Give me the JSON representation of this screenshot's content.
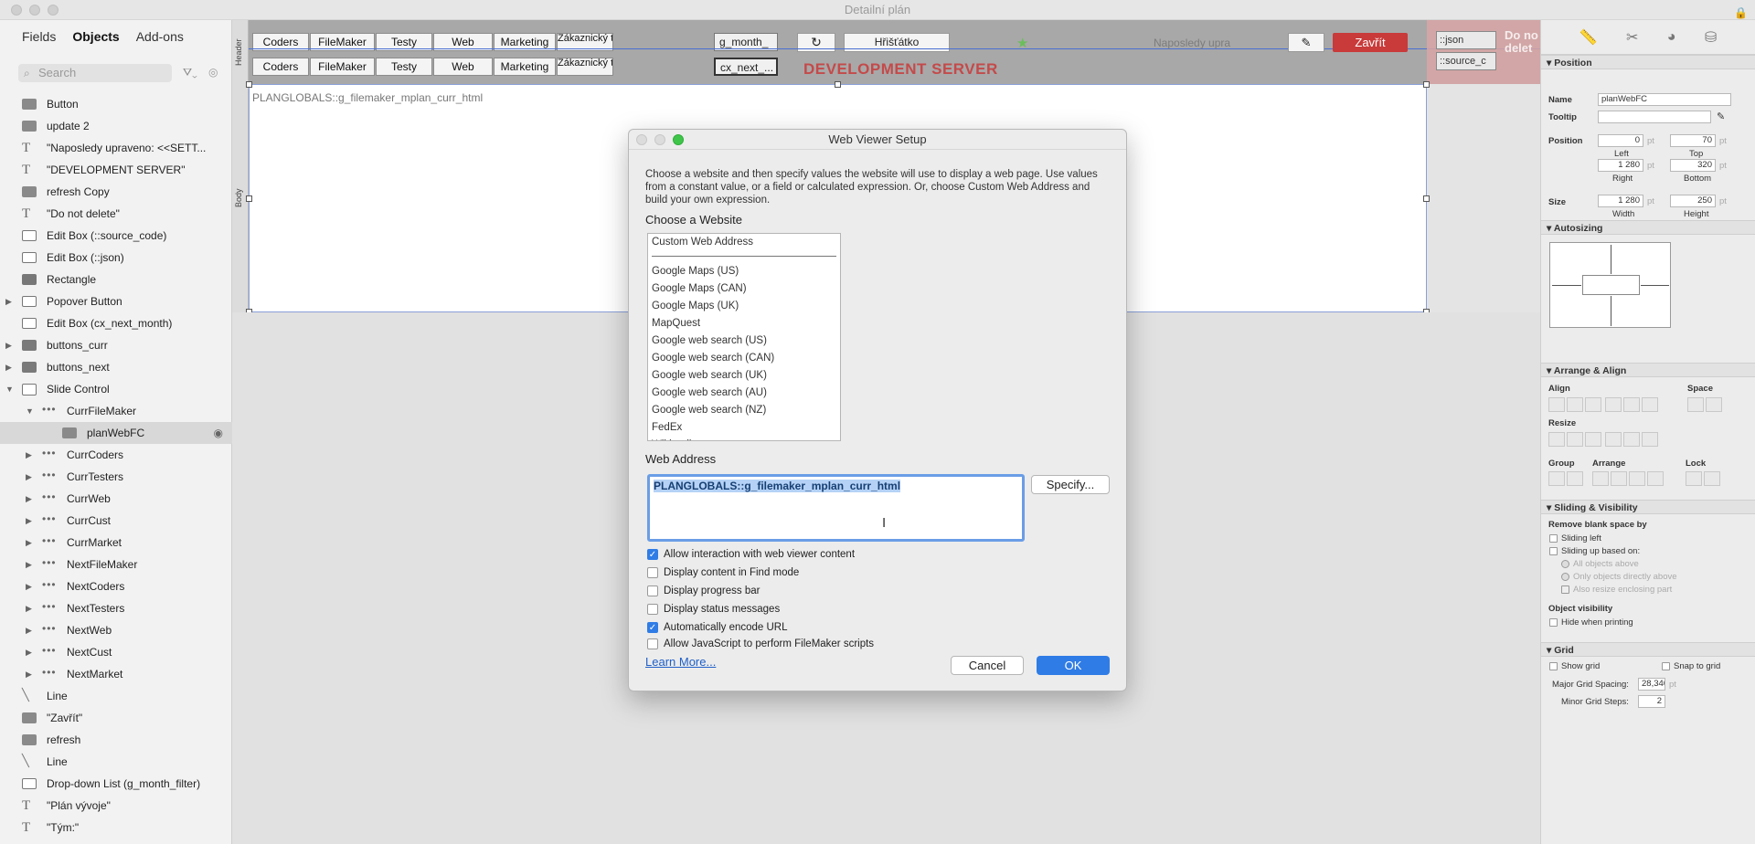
{
  "window": {
    "title": "Detailní plán"
  },
  "left_panel": {
    "tabs": [
      "Fields",
      "Objects",
      "Add-ons"
    ],
    "active_tab": "Objects",
    "search_placeholder": "Search",
    "objects": [
      {
        "label": "Button",
        "icon": "button-icon",
        "indent": 0
      },
      {
        "label": "update 2",
        "icon": "button-icon",
        "indent": 0
      },
      {
        "label": "\"Naposledy upraveno: <<SETT...",
        "icon": "text-icon",
        "indent": 0
      },
      {
        "label": "\"DEVELOPMENT SERVER\"",
        "icon": "text-icon",
        "indent": 0
      },
      {
        "label": "refresh Copy",
        "icon": "button-icon",
        "indent": 0
      },
      {
        "label": "\"Do not delete\"",
        "icon": "text-icon",
        "indent": 0
      },
      {
        "label": "Edit Box (::source_code)",
        "icon": "edit-box-icon",
        "indent": 0
      },
      {
        "label": "Edit Box (::json)",
        "icon": "edit-box-icon",
        "indent": 0
      },
      {
        "label": "Rectangle",
        "icon": "rectangle-icon",
        "indent": 0
      },
      {
        "label": "Popover Button",
        "icon": "popover-icon",
        "indent": 0,
        "expander": "collapsed"
      },
      {
        "label": "Edit Box (cx_next_month)",
        "icon": "edit-box-icon",
        "indent": 0
      },
      {
        "label": "buttons_curr",
        "icon": "button-bar-icon",
        "indent": 0,
        "expander": "collapsed"
      },
      {
        "label": "buttons_next",
        "icon": "button-bar-icon",
        "indent": 0,
        "expander": "collapsed"
      },
      {
        "label": "Slide Control",
        "icon": "slide-control-icon",
        "indent": 0,
        "expander": "expanded"
      },
      {
        "label": "CurrFileMaker",
        "icon": "panel-dots-icon",
        "indent": 1,
        "expander": "expanded"
      },
      {
        "label": "planWebFC",
        "icon": "web-viewer-icon",
        "indent": 2,
        "selected": true
      },
      {
        "label": "CurrCoders",
        "icon": "panel-dots-icon",
        "indent": 1,
        "expander": "collapsed"
      },
      {
        "label": "CurrTesters",
        "icon": "panel-dots-icon",
        "indent": 1,
        "expander": "collapsed"
      },
      {
        "label": "CurrWeb",
        "icon": "panel-dots-icon",
        "indent": 1,
        "expander": "collapsed"
      },
      {
        "label": "CurrCust",
        "icon": "panel-dots-icon",
        "indent": 1,
        "expander": "collapsed"
      },
      {
        "label": "CurrMarket",
        "icon": "panel-dots-icon",
        "indent": 1,
        "expander": "collapsed"
      },
      {
        "label": "NextFileMaker",
        "icon": "panel-dots-icon",
        "indent": 1,
        "expander": "collapsed"
      },
      {
        "label": "NextCoders",
        "icon": "panel-dots-icon",
        "indent": 1,
        "expander": "collapsed"
      },
      {
        "label": "NextTesters",
        "icon": "panel-dots-icon",
        "indent": 1,
        "expander": "collapsed"
      },
      {
        "label": "NextWeb",
        "icon": "panel-dots-icon",
        "indent": 1,
        "expander": "collapsed"
      },
      {
        "label": "NextCust",
        "icon": "panel-dots-icon",
        "indent": 1,
        "expander": "collapsed"
      },
      {
        "label": "NextMarket",
        "icon": "panel-dots-icon",
        "indent": 1,
        "expander": "collapsed"
      },
      {
        "label": "Line",
        "icon": "line-icon",
        "indent": 0
      },
      {
        "label": "\"Zavřít\"",
        "icon": "button-icon",
        "indent": 0
      },
      {
        "label": "refresh",
        "icon": "button-icon",
        "indent": 0
      },
      {
        "label": "Line",
        "icon": "line-icon",
        "indent": 0
      },
      {
        "label": "Drop-down List (g_month_filter)",
        "icon": "dropdown-icon",
        "indent": 0
      },
      {
        "label": "\"Plán vývoje\"",
        "icon": "text-icon",
        "indent": 0
      },
      {
        "label": "\"Tým:\"",
        "icon": "text-icon",
        "indent": 0
      }
    ]
  },
  "layout": {
    "part_header": "Header",
    "part_body": "Body",
    "buttons_row1": [
      "Coders",
      "FileMaker",
      "Testy",
      "Web",
      "Marketing",
      "Zákaznický tým"
    ],
    "buttons_row2": [
      "Coders",
      "FileMaker",
      "Testy",
      "Web",
      "Marketing",
      "Zákaznický tým"
    ],
    "field_month": "g_month_",
    "field_next": "cx_next_...",
    "dev_server": "DEVELOPMENT SERVER",
    "hristatko": "Hřišťátko",
    "naposledy": "Naposledy upra",
    "zavrit": "Zavřít",
    "json_field": "::json",
    "source_field": "::source_c",
    "do_not_delete": "Do no delet",
    "webviewer_label": "PLANGLOBALS::g_filemaker_mplan_curr_html"
  },
  "dialog": {
    "title": "Web Viewer Setup",
    "description": "Choose a website and then specify values the website will use to display a web page. Use values from a constant value, or a field or calculated expression. Or, choose Custom Web Address and build your own expression.",
    "choose_label": "Choose a Website",
    "sites_top": "Custom Web Address",
    "sites": [
      "Google Maps (US)",
      "Google Maps (CAN)",
      "Google Maps (UK)",
      "MapQuest",
      "Google web search (US)",
      "Google web search (CAN)",
      "Google web search (UK)",
      "Google web search (AU)",
      "Google web search (NZ)",
      "FedEx",
      "Wikipedia"
    ],
    "web_address_label": "Web Address",
    "web_address_value": "PLANGLOBALS::g_filemaker_mplan_curr_html",
    "specify": "Specify...",
    "options": [
      {
        "label": "Allow interaction with web viewer content",
        "checked": true
      },
      {
        "label": "Display content in Find mode",
        "checked": false
      },
      {
        "label": "Display progress bar",
        "checked": false
      },
      {
        "label": "Display status messages",
        "checked": false
      },
      {
        "label": "Automatically encode URL",
        "checked": true
      },
      {
        "label": "Allow JavaScript to perform FileMaker scripts",
        "checked": false
      }
    ],
    "learn_more": "Learn More...",
    "cancel": "Cancel",
    "ok": "OK"
  },
  "inspector": {
    "position_section": "Position",
    "name_label": "Name",
    "name_value": "planWebFC",
    "tooltip_label": "Tooltip",
    "position_label": "Position",
    "left_value": "0",
    "top_value": "70",
    "left_label": "Left",
    "top_label": "Top",
    "right_value": "1 280",
    "bottom_value": "320",
    "right_label": "Right",
    "bottom_label": "Bottom",
    "size_label": "Size",
    "width_value": "1 280",
    "height_value": "250",
    "width_label": "Width",
    "height_label": "Height",
    "unit": "pt",
    "autosizing_section": "Autosizing",
    "arrange_section": "Arrange & Align",
    "align_label": "Align",
    "space_label": "Space",
    "resize_label": "Resize",
    "group_label": "Group",
    "arrange_label": "Arrange",
    "lock_label": "Lock",
    "sliding_section": "Sliding & Visibility",
    "remove_blank": "Remove blank space by",
    "sliding_left": "Sliding left",
    "sliding_up": "Sliding up based on:",
    "all_objects_above": "All objects above",
    "only_objects_directly_above": "Only objects directly above",
    "also_resize": "Also resize enclosing part",
    "object_visibility": "Object visibility",
    "hide_printing": "Hide when printing",
    "grid_section": "Grid",
    "show_grid": "Show grid",
    "snap_grid": "Snap to grid",
    "major_spacing_label": "Major Grid Spacing:",
    "major_spacing_value": "28,346",
    "minor_steps_label": "Minor Grid Steps:",
    "minor_steps_value": "2"
  },
  "colors": {
    "accent": "#2f7ce6",
    "close_button": "#c93a3a",
    "dev_server_text": "#c44a4a"
  }
}
